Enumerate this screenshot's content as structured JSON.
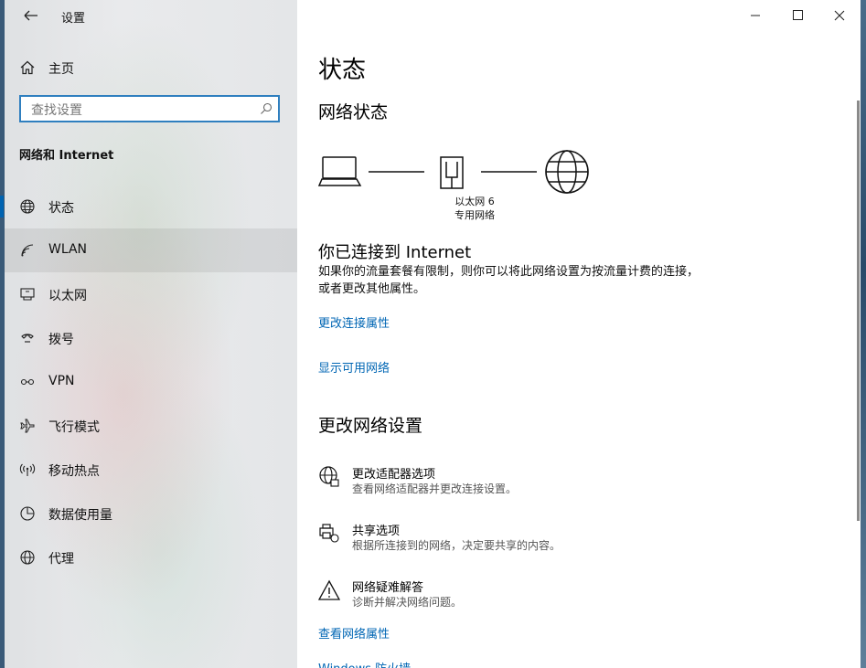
{
  "app": {
    "title": "设置"
  },
  "sidebar": {
    "home_label": "主页",
    "search_placeholder": "查找设置",
    "section_title": "网络和 Internet",
    "items": [
      {
        "label": "状态",
        "icon": "globe-icon"
      },
      {
        "label": "WLAN",
        "icon": "wifi-icon"
      },
      {
        "label": "以太网",
        "icon": "ethernet-icon"
      },
      {
        "label": "拨号",
        "icon": "dialup-icon"
      },
      {
        "label": "VPN",
        "icon": "vpn-icon"
      },
      {
        "label": "飞行模式",
        "icon": "airplane-icon"
      },
      {
        "label": "移动热点",
        "icon": "hotspot-icon"
      },
      {
        "label": "数据使用量",
        "icon": "data-usage-icon"
      },
      {
        "label": "代理",
        "icon": "globe-icon"
      }
    ]
  },
  "main": {
    "title": "状态",
    "network_status_title": "网络状态",
    "adapter_name": "以太网 6",
    "network_type": "专用网络",
    "connected_title": "你已连接到 Internet",
    "connected_desc": "如果你的流量套餐有限制，则你可以将此网络设置为按流量计费的连接，或者更改其他属性。",
    "link_change_props": "更改连接属性",
    "link_show_networks": "显示可用网络",
    "change_settings_title": "更改网络设置",
    "options": [
      {
        "title": "更改适配器选项",
        "desc": "查看网络适配器并更改连接设置。",
        "icon": "adapter-globe-icon"
      },
      {
        "title": "共享选项",
        "desc": "根据所连接到的网络，决定要共享的内容。",
        "icon": "sharing-icon"
      },
      {
        "title": "网络疑难解答",
        "desc": "诊断并解决网络问题。",
        "icon": "warning-icon"
      }
    ],
    "link_view_props": "查看网络属性",
    "link_firewall": "Windows 防火墙"
  },
  "colors": {
    "accent": "#0063b1",
    "link": "#0066b4",
    "search_border": "#2f7fbf"
  }
}
